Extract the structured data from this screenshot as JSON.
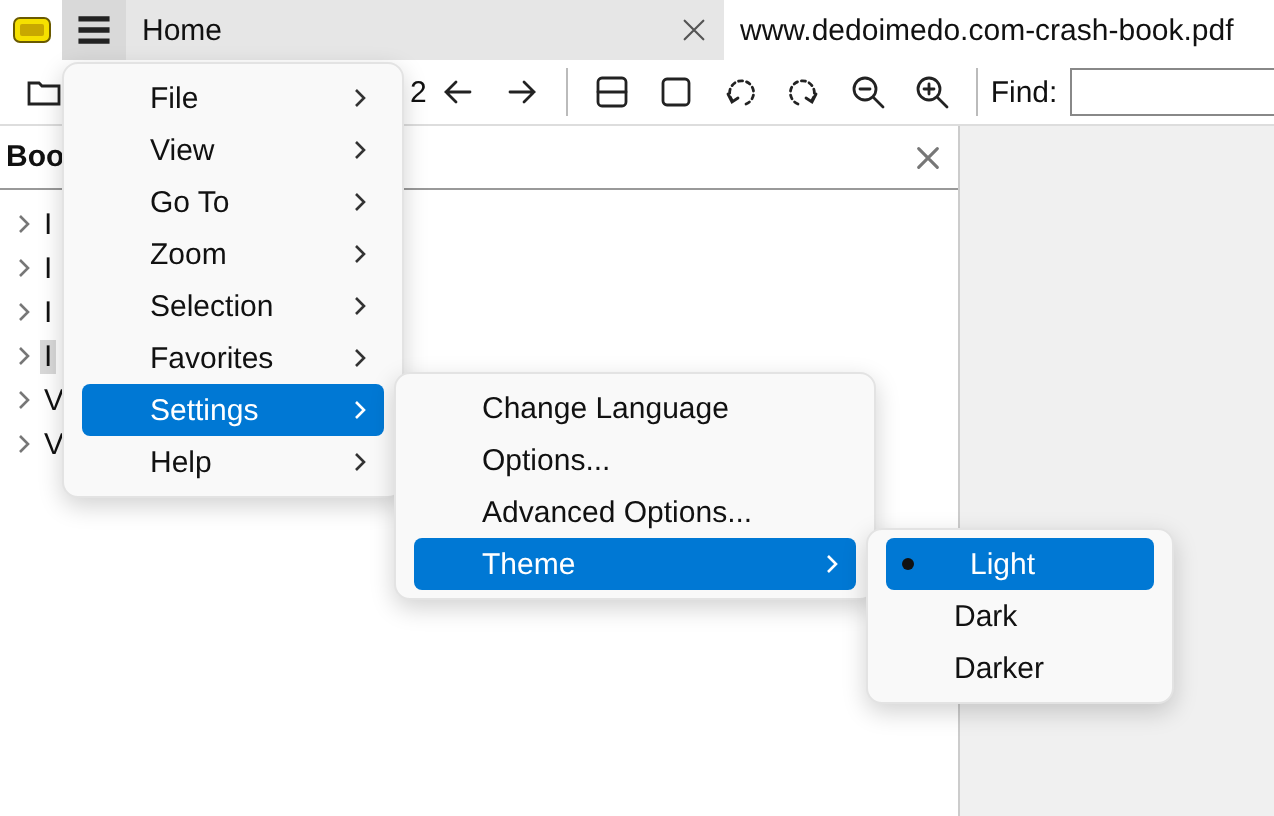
{
  "tabs": [
    {
      "label": "Home",
      "selected": true
    },
    {
      "label": "www.dedoimedo.com-crash-book.pdf",
      "selected": false
    }
  ],
  "toolbar": {
    "page_count_fragment": "2",
    "find_label": "Find:"
  },
  "bookmarks": {
    "title": "Boo",
    "items": [
      {
        "label": "I",
        "selected": false
      },
      {
        "label": "I",
        "selected": false
      },
      {
        "label": "I",
        "selected": false
      },
      {
        "label": "I",
        "selected": true
      },
      {
        "label": "V",
        "selected": false
      },
      {
        "label": "V",
        "selected": false
      }
    ]
  },
  "menu": {
    "items": [
      {
        "label": "File",
        "selected": false
      },
      {
        "label": "View",
        "selected": false
      },
      {
        "label": "Go To",
        "selected": false
      },
      {
        "label": "Zoom",
        "selected": false
      },
      {
        "label": "Selection",
        "selected": false
      },
      {
        "label": "Favorites",
        "selected": false
      },
      {
        "label": "Settings",
        "selected": true
      },
      {
        "label": "Help",
        "selected": false
      }
    ]
  },
  "settings_menu": {
    "items": [
      {
        "label": "Change Language",
        "has_submenu": false,
        "selected": false
      },
      {
        "label": "Options...",
        "has_submenu": false,
        "selected": false
      },
      {
        "label": "Advanced Options...",
        "has_submenu": false,
        "selected": false
      },
      {
        "label": "Theme",
        "has_submenu": true,
        "selected": true
      }
    ]
  },
  "theme_menu": {
    "items": [
      {
        "label": "Light",
        "checked": true,
        "selected": true
      },
      {
        "label": "Dark",
        "checked": false,
        "selected": false
      },
      {
        "label": "Darker",
        "checked": false,
        "selected": false
      }
    ]
  }
}
